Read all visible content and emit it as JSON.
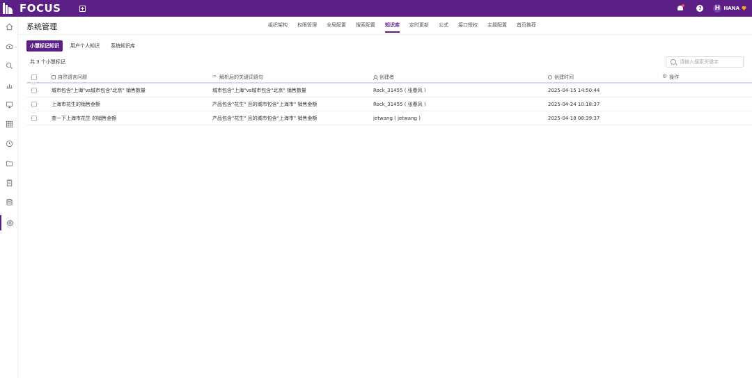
{
  "app": {
    "logo_text": "FOCUS",
    "user_initial": "H",
    "user_name": "HANA"
  },
  "page": {
    "title": "系统管理"
  },
  "nav": {
    "items": [
      "组织架构",
      "权限管理",
      "全局配置",
      "搜索配置",
      "知识库",
      "定时更新",
      "公式",
      "接口授权",
      "主题配置",
      "首页推荐"
    ],
    "active_index": 4
  },
  "subtabs": {
    "items": [
      "小慧标记知识",
      "用户个人知识",
      "系统知识库"
    ],
    "active_index": 0
  },
  "summary": {
    "count_text": "共 3 个小慧标记"
  },
  "search": {
    "placeholder": "请输入搜索关键字"
  },
  "table": {
    "columns": [
      "自然语言问题",
      "解析后的关键词语句",
      "创建者",
      "创建时间",
      "操作"
    ],
    "rows": [
      {
        "question": "城市包含\"上海\"vs城市包含\"北京\" 销售数量",
        "parsed": "城市包含\"上海\"vs城市包含\"北京\" 销售数量",
        "creator": "Rock_31455 ( 张春风 )",
        "created": "2025-04-15 14:50:44"
      },
      {
        "question": "上海市花生的销售金额",
        "parsed": "产品包含\"花生\" 且的城市包含\"上海市\" 销售金额",
        "creator": "Rock_31455 ( 张春风 )",
        "created": "2025-04-24 10:18:37"
      },
      {
        "question": "查一下上海市花生 的销售金额",
        "parsed": "产品包含\"花生\" 且的城市包含\"上海市\" 销售金额",
        "creator": "jetwang ( jetwang )",
        "created": "2025-04-18 08:39:37"
      }
    ]
  },
  "sidebar": {
    "icons": [
      "home-icon",
      "cloud-upload-icon",
      "search-icon",
      "chart-icon",
      "monitor-icon",
      "table-icon",
      "clock-icon",
      "folder-icon",
      "clipboard-icon",
      "database-icon",
      "settings-icon"
    ],
    "active_index": 10
  },
  "colors": {
    "brand": "#5b1f86",
    "notification": "#ff4d4f",
    "badge": "#f5a623"
  }
}
